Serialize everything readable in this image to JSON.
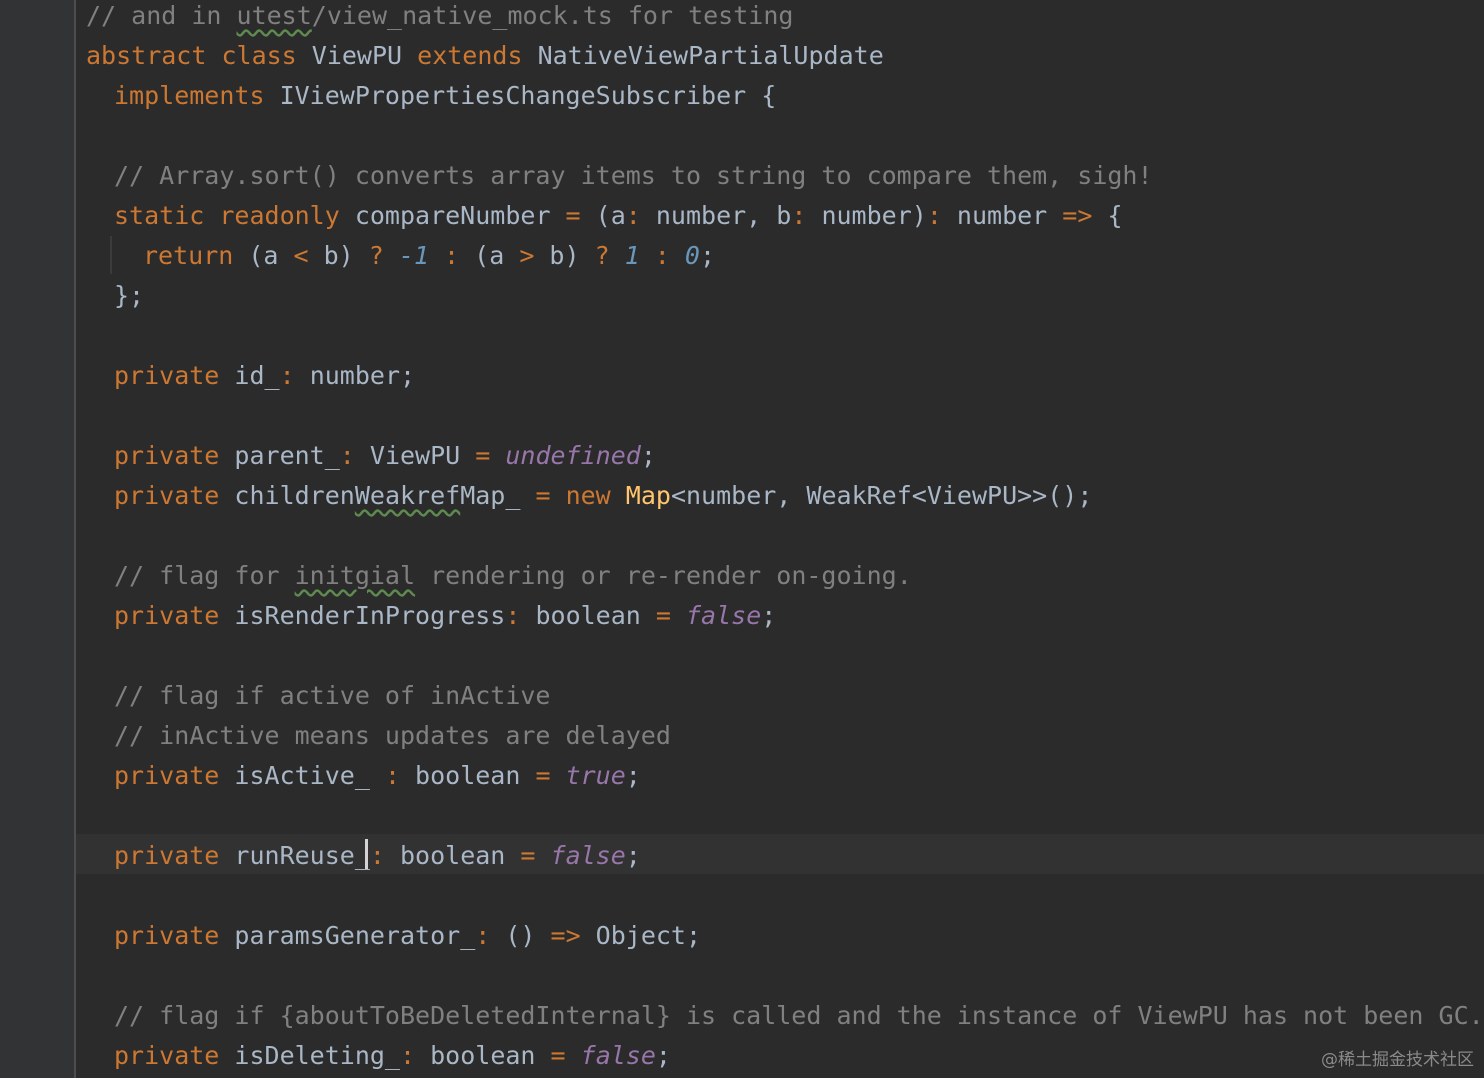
{
  "code": {
    "l1": {
      "a": "// and in ",
      "b": "utest",
      "c": "/view_native_mock.ts for testing"
    },
    "l2": {
      "a": "abstract ",
      "b": "class ",
      "c": "ViewPU ",
      "d": "extends ",
      "e": "NativeViewPartialUpdate"
    },
    "l3": {
      "a": "implements ",
      "b": "IViewPropertiesChangeSubscriber {"
    },
    "l5": {
      "a": "// Array.sort() converts array items to string to compare them, sigh!"
    },
    "l6": {
      "a": "static ",
      "b": "readonly ",
      "c": "compareNumber ",
      "d": "= ",
      "e": "(a",
      "f": ": ",
      "g": "number, b",
      "h": ": ",
      "i": "number)",
      "j": ": ",
      "k": "number ",
      "l": "=> ",
      "m": "{"
    },
    "l7": {
      "a": "return ",
      "b": "(a ",
      "c": "< ",
      "d": "b) ",
      "e": "? ",
      "f": "-1 ",
      "g": ": ",
      "h": "(a ",
      "i": "> ",
      "j": "b) ",
      "k": "? ",
      "l": "1 ",
      "m": ": ",
      "n": "0",
      "o": ";"
    },
    "l8": {
      "a": "};"
    },
    "l10": {
      "a": "private ",
      "b": "id_",
      "c": ": ",
      "d": "number;"
    },
    "l12": {
      "a": "private ",
      "b": "parent_",
      "c": ": ",
      "d": "ViewPU ",
      "e": "= ",
      "f": "undefined",
      "g": ";"
    },
    "l13": {
      "a": "private ",
      "b": "children",
      "c": "Weakref",
      "d": "Map_ ",
      "e": "= ",
      "f": "new ",
      "g": "Map",
      "h": "<number, WeakRef<ViewPU>>();"
    },
    "l15": {
      "a": "// flag for ",
      "b": "initgial",
      "c": " rendering or re-render on-going."
    },
    "l16": {
      "a": "private ",
      "b": "isRenderInProgress",
      "c": ": ",
      "d": "boolean ",
      "e": "= ",
      "f": "false",
      "g": ";"
    },
    "l18": {
      "a": "// flag if active of inActive"
    },
    "l19": {
      "a": "// inActive means updates are delayed"
    },
    "l20": {
      "a": "private ",
      "b": "isActive_ ",
      "c": ": ",
      "d": "boolean ",
      "e": "= ",
      "f": "true",
      "g": ";"
    },
    "l22": {
      "a": "private ",
      "b": "runReuse_",
      "c": ": ",
      "d": "boolean ",
      "e": "= ",
      "f": "false",
      "g": ";"
    },
    "l24": {
      "a": "private ",
      "b": "paramsGenerator_",
      "c": ": ",
      "d": "() ",
      "e": "=> ",
      "f": "Object;"
    },
    "l26": {
      "a": "// flag if {aboutToBeDeletedInternal} is called and the instance of ViewPU has not been GC."
    },
    "l27": {
      "a": "private ",
      "b": "isDeleting_",
      "c": ": ",
      "d": "boolean ",
      "e": "= ",
      "f": "false",
      "g": ";"
    }
  },
  "watermark": "@稀土掘金技术社区",
  "colors": {
    "background": "#2b2b2b",
    "gutter": "#313335",
    "current_line": "#323232",
    "keyword": "#cc7832",
    "text": "#a9b7c6",
    "comment": "#808080",
    "number": "#6897bb",
    "literal": "#9876aa",
    "class_name": "#ffc66d"
  }
}
